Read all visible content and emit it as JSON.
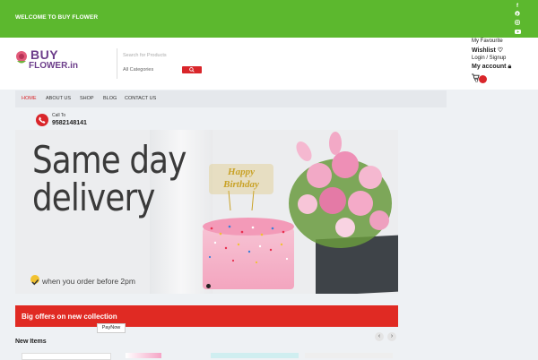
{
  "topbar": {
    "welcome": "WELCOME TO BUY FLOWER"
  },
  "social": [
    "f",
    "p",
    "ig",
    "yt"
  ],
  "logo": {
    "buy": "BUY",
    "site": "FLOWER.in"
  },
  "search": {
    "placeholder": "Search for Products",
    "category": "All Categories"
  },
  "account": {
    "favourite": "My Favourite",
    "wishlist": "Wishlist",
    "login": "Login / Signup",
    "my_account": "My account",
    "cart_count": "0"
  },
  "nav": {
    "items": [
      "HOME",
      "ABOUT US",
      "SHOP",
      "BLOG",
      "CONTACT US"
    ],
    "active_index": 0
  },
  "call": {
    "label": "Call To",
    "number": "9582148141"
  },
  "banner": {
    "line1": "Same day",
    "line2": "delivery",
    "cake_topper": "Happy Birthday",
    "note": "when you order before 2pm"
  },
  "offer": {
    "text": "Big offers on new collection"
  },
  "section": {
    "new_items": "New Items",
    "paynow": "PayNow",
    "prev": "‹",
    "next": "›"
  },
  "colors": {
    "top_green": "#5cb82e",
    "accent_red": "#d9262b",
    "brand_purple": "#6c3d8a"
  }
}
